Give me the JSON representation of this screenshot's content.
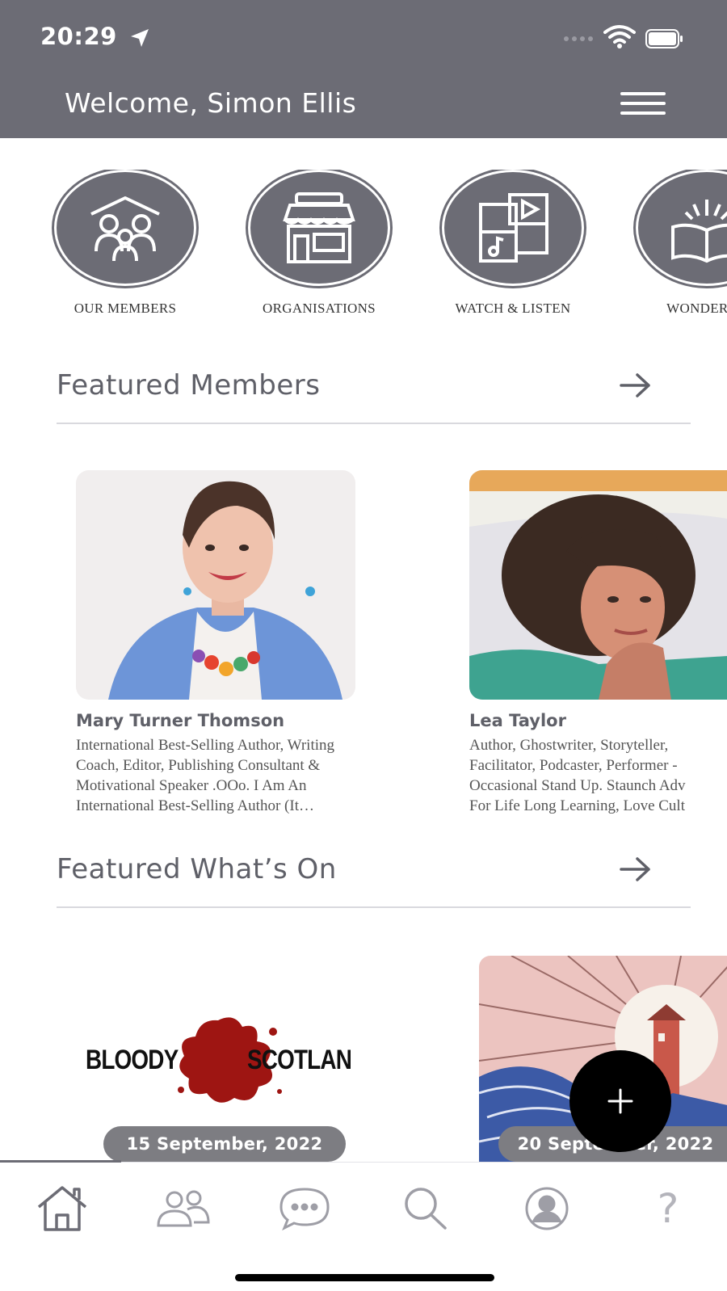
{
  "status_bar": {
    "time": "20:29"
  },
  "header": {
    "welcome": "Welcome, Simon Ellis"
  },
  "categories": [
    {
      "label": "OUR MEMBERS",
      "icon": "members-icon"
    },
    {
      "label": "ORGANISATIONS",
      "icon": "storefront-icon"
    },
    {
      "label": "WATCH & LISTEN",
      "icon": "media-icon"
    },
    {
      "label": "WONDERLA",
      "icon": "open-book-icon"
    }
  ],
  "featured_members": {
    "title": "Featured Members",
    "members": [
      {
        "name": "Mary Turner Thomson",
        "bio": "International Best-Selling Author, Writing\nCoach, Editor, Publishing Consultant &\nMotivational Speaker .OOo. I Am An\nInternational Best-Selling Author (It…"
      },
      {
        "name": "Lea Taylor",
        "bio": "Author, Ghostwriter, Storyteller,\nFacilitator, Podcaster, Performer -\nOccasional Stand Up. Staunch Adv\nFor Life Long Learning, Love Cult"
      }
    ]
  },
  "featured_whats_on": {
    "title": "Featured What’s On",
    "events": [
      {
        "logo_left": "BLOODY",
        "logo_right": "SCOTLAN",
        "date": "15 September, 2022"
      },
      {
        "date": "20 September, 2022"
      }
    ]
  },
  "fab": {
    "symbol": "+"
  },
  "tabbar": {
    "tabs": [
      {
        "name": "home",
        "icon": "home-icon"
      },
      {
        "name": "members",
        "icon": "people-icon"
      },
      {
        "name": "messages",
        "icon": "chat-icon"
      },
      {
        "name": "search",
        "icon": "search-icon"
      },
      {
        "name": "profile",
        "icon": "profile-icon"
      },
      {
        "name": "help",
        "icon": "help-icon",
        "glyph": "?"
      }
    ]
  },
  "colors": {
    "header": "#6c6c75",
    "text": "#5f6068",
    "date_pill": "#7d7d82",
    "fab": "#000000"
  }
}
